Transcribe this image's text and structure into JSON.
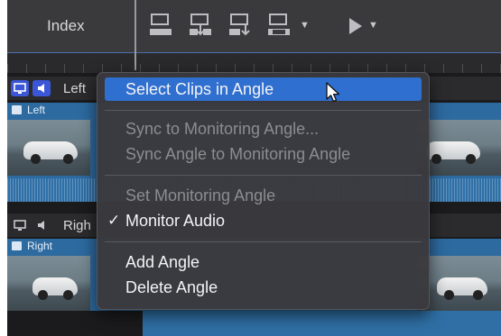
{
  "toolbar": {
    "index_label": "Index"
  },
  "angles": [
    {
      "header_label": "Left",
      "clip_title": "Left"
    },
    {
      "header_label": "Righ",
      "clip_title": "Right"
    }
  ],
  "menu": {
    "items": [
      {
        "label": "Select Clips in Angle",
        "enabled": true,
        "selected": true
      },
      {
        "label": "Sync to Monitoring Angle...",
        "enabled": false
      },
      {
        "label": "Sync Angle to Monitoring Angle",
        "enabled": false
      },
      {
        "label": "Set Monitoring Angle",
        "enabled": false
      },
      {
        "label": "Monitor Audio",
        "enabled": true,
        "checked": true
      },
      {
        "label": "Add Angle",
        "enabled": true
      },
      {
        "label": "Delete Angle",
        "enabled": true
      }
    ],
    "check_glyph": "✓"
  },
  "colors": {
    "selection": "#2f6fcf",
    "clip_blue": "#2d6a9f",
    "angle_active": "#3b56d6"
  }
}
